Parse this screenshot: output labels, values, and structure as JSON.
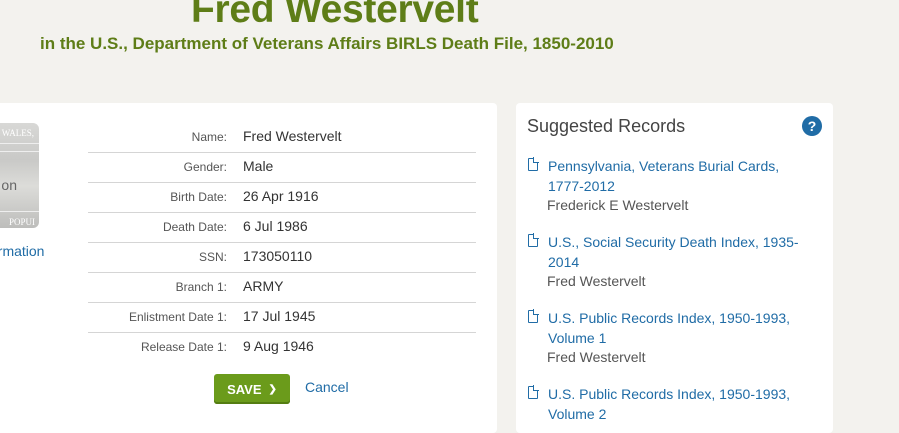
{
  "header": {
    "person_name": "Fred Westervelt",
    "collection": "in the U.S., Department of Veterans Affairs BIRLS Death File, 1850-2010"
  },
  "thumbnail": {
    "text_top": "WALES,",
    "text_mid": "on",
    "text_bottom": "POPUI",
    "link_label": "ormation"
  },
  "record": {
    "fields": [
      {
        "label": "Name:",
        "value": "Fred Westervelt"
      },
      {
        "label": "Gender:",
        "value": "Male"
      },
      {
        "label": "Birth Date:",
        "value": "26 Apr 1916"
      },
      {
        "label": "Death Date:",
        "value": "6 Jul 1986"
      },
      {
        "label": "SSN:",
        "value": "173050110"
      },
      {
        "label": "Branch 1:",
        "value": "ARMY"
      },
      {
        "label": "Enlistment Date 1:",
        "value": "17 Jul 1945"
      },
      {
        "label": "Release Date 1:",
        "value": "9 Aug 1946"
      }
    ],
    "save_label": "SAVE",
    "cancel_label": "Cancel"
  },
  "suggested": {
    "title": "Suggested Records",
    "help_glyph": "?",
    "items": [
      {
        "title": "Pennsylvania, Veterans Burial Cards, 1777-2012",
        "name": "Frederick E Westervelt"
      },
      {
        "title": "U.S., Social Security Death Index, 1935-2014",
        "name": "Fred Westervelt"
      },
      {
        "title": "U.S. Public Records Index, 1950-1993, Volume 1",
        "name": "Fred Westervelt"
      },
      {
        "title": "U.S. Public Records Index, 1950-1993, Volume 2",
        "name": ""
      }
    ]
  },
  "colors": {
    "title_green": "#5e7d17",
    "link_blue": "#206ca6",
    "save_green": "#6b9b1b",
    "page_bg": "#f3f2ee"
  }
}
